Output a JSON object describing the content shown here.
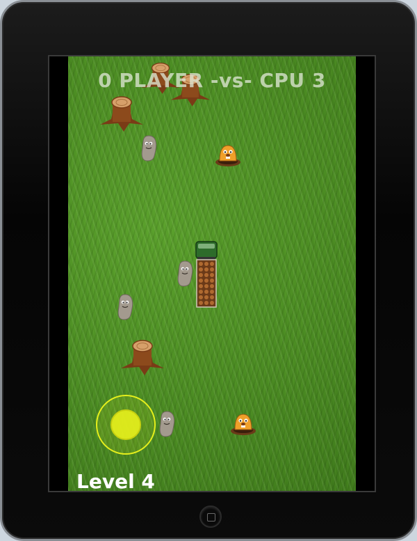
{
  "game": {
    "scoreboard": "0 PLAYER -vs- CPU 3",
    "level_label": "Level 4"
  },
  "colors": {
    "grass": "#4f8f25",
    "joystick": "#e6ef1c",
    "hud_text": "#dce6d2",
    "level_text": "#ffffff"
  },
  "entities": {
    "stumps": [
      "tree-stump",
      "tree-stump",
      "tree-stump",
      "tree-stump"
    ],
    "potatoes": [
      "potato-character",
      "potato-character",
      "potato-character",
      "potato-character"
    ],
    "moles": [
      "mole-character",
      "mole-character"
    ],
    "player": "log-truck"
  }
}
